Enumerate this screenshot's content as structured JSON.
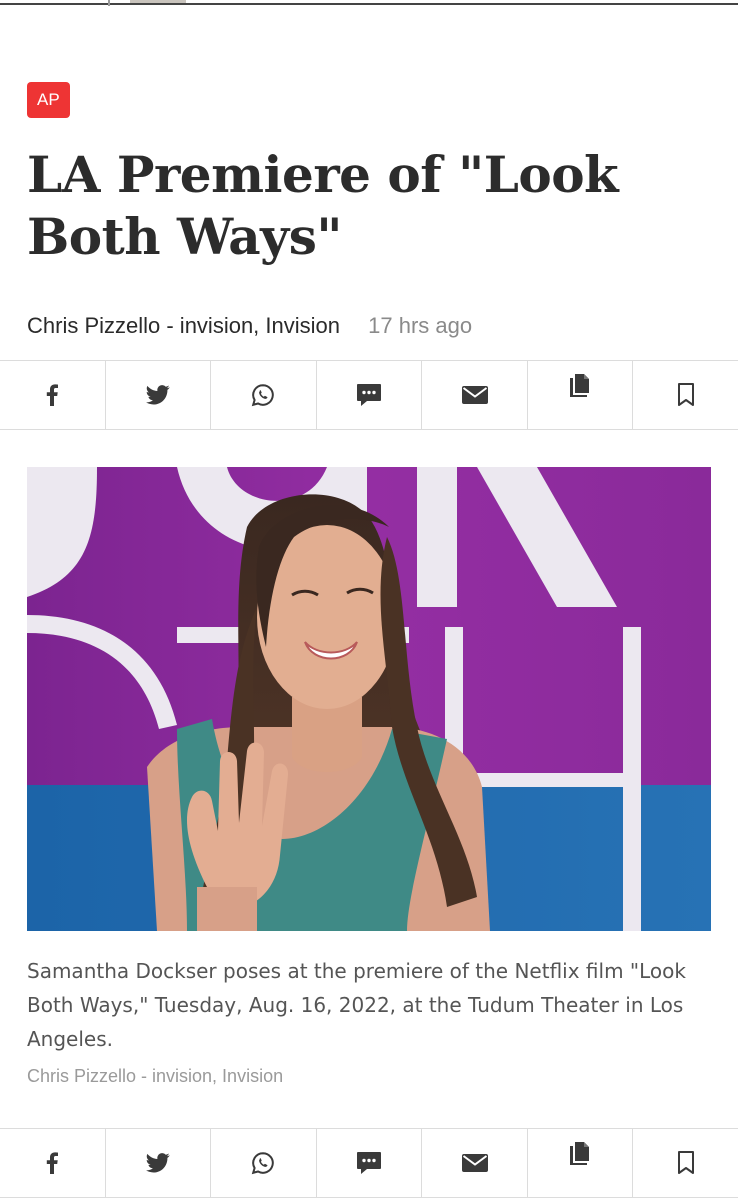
{
  "source_badge": "AP",
  "headline": "LA Premiere of \"Look Both Ways\"",
  "byline": {
    "author": "Chris Pizzello - invision, Invision",
    "time": "17 hrs ago"
  },
  "share_bar": [
    "facebook-icon",
    "twitter-icon",
    "whatsapp-icon",
    "comment-icon",
    "email-icon",
    "copy-icon",
    "bookmark-icon"
  ],
  "photo": {
    "caption": "Samantha Dockser poses at the premiere of the Netflix film \"Look Both Ways,\" Tuesday, Aug. 16, 2022, at the Tudum Theater in Los Angeles.",
    "credit": "Chris Pizzello - invision, Invision"
  },
  "colors": {
    "badge": "#ee3434",
    "backdrop_purple": "#8e2a9c",
    "backdrop_blue": "#1f6bb0"
  }
}
